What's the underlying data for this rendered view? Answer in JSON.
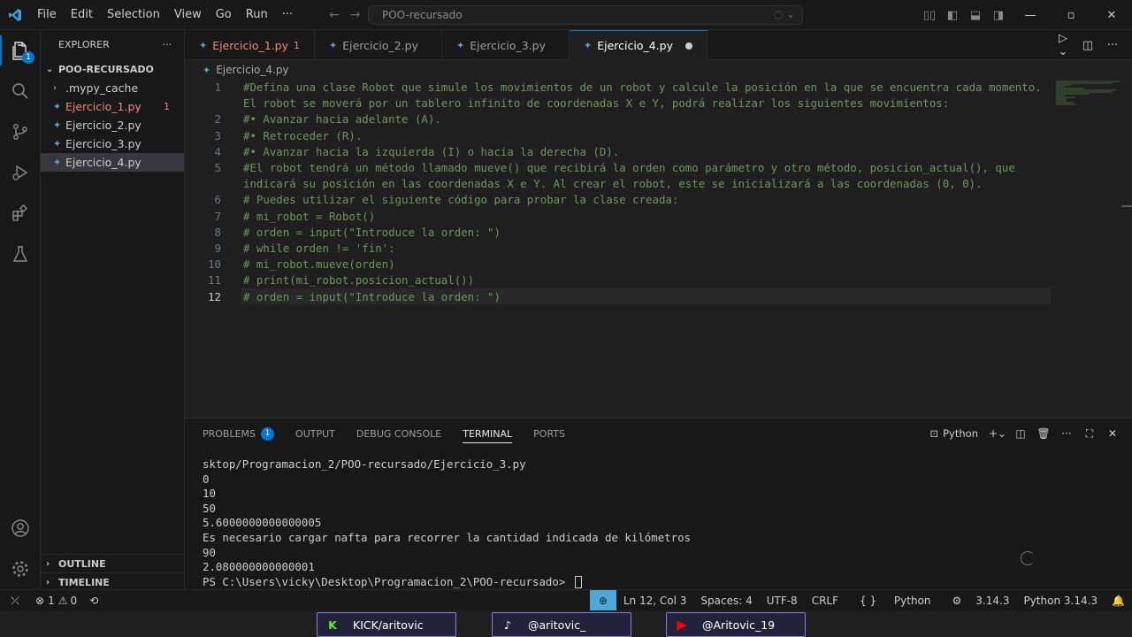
{
  "titlebar": {
    "menu": [
      "File",
      "Edit",
      "Selection",
      "View",
      "Go",
      "Run",
      "···"
    ],
    "search": "POO-recursado"
  },
  "explorer": {
    "title": "EXPLORER",
    "folder": "POO-RECURSADO",
    "items": [
      {
        "label": ".mypy_cache"
      },
      {
        "label": "Ejercicio_1.py",
        "count": "1"
      },
      {
        "label": "Ejercicio_2.py"
      },
      {
        "label": "Ejercicio_3.py"
      },
      {
        "label": "Ejercicio_4.py"
      }
    ],
    "outline": "OUTLINE",
    "timeline": "TIMELINE"
  },
  "activity_badge": "1",
  "tabs": [
    {
      "label": "Ejercicio_1.py",
      "count": "1"
    },
    {
      "label": "Ejercicio_2.py"
    },
    {
      "label": "Ejercicio_3.py"
    },
    {
      "label": "Ejercicio_4.py"
    }
  ],
  "breadcrumb": "Ejercicio_4.py",
  "editor": {
    "lines": [
      {
        "n": "1",
        "text": "#Defina una clase Robot que simule los movimientos de un robot y calcule la posición en la que se encuentra cada momento."
      },
      {
        "n": "",
        "text": "El robot se moverá por un tablero infinito de coordenadas X e Y, podrá realizar los siguientes movimientos:"
      },
      {
        "n": "2",
        "text": "#• Avanzar hacia adelante (A)."
      },
      {
        "n": "3",
        "text": "#• Retroceder (R)."
      },
      {
        "n": "4",
        "text": "#• Avanzar hacia la izquierda (I) o hacia la derecha (D)."
      },
      {
        "n": "5",
        "text": "#El robot tendrá un método llamado mueve() que recibirá la orden como parámetro y otro método, posicion_actual(), que"
      },
      {
        "n": "",
        "text": "indicará su posición en las coordenadas X e Y. Al crear el robot, este se inicializará a las coordenadas (0, 0)."
      },
      {
        "n": "6",
        "text": "# Puedes utilizar el siguiente código para probar la clase creada:"
      },
      {
        "n": "7",
        "text": "# mi_robot = Robot()"
      },
      {
        "n": "8",
        "text": "# orden = input(\"Introduce la orden: \")"
      },
      {
        "n": "9",
        "text": "# while orden != 'fin':"
      },
      {
        "n": "10",
        "text": "# mi_robot.mueve(orden)"
      },
      {
        "n": "11",
        "text": "# print(mi_robot.posicion_actual())"
      },
      {
        "n": "12",
        "text": "# orden = input(\"Introduce la orden: \")"
      }
    ]
  },
  "panel": {
    "tabs": [
      "PROBLEMS",
      "OUTPUT",
      "DEBUG CONSOLE",
      "TERMINAL",
      "PORTS"
    ],
    "problems_count": "1",
    "terminal_name": "Python",
    "terminal_lines": [
      "sktop/Programacion_2/POO-recursado/Ejercicio_3.py",
      "0",
      "10",
      "50",
      "5.6000000000000005",
      "Es necesario cargar nafta para recorrer la cantidad indicada de kilómetros",
      "90",
      "2.080000000000001"
    ],
    "prompt": "PS C:\\Users\\vicky\\Desktop\\Programacion_2\\POO-recursado> "
  },
  "status": {
    "errors": "1",
    "warnings": "0",
    "position": "Ln 12, Col 3",
    "spaces": "Spaces: 4",
    "encoding": "UTF-8",
    "eol": "CRLF",
    "language": "Python",
    "version": "3.14.3",
    "interpreter": "Python 3.14.3"
  },
  "overlay": {
    "kick": "KICK/aritovic",
    "tiktok": "@aritovic_",
    "youtube": "@Aritovic_19"
  },
  "colors": {
    "accent": "#0078d4",
    "comment": "#6a9955",
    "error": "#f48771"
  }
}
